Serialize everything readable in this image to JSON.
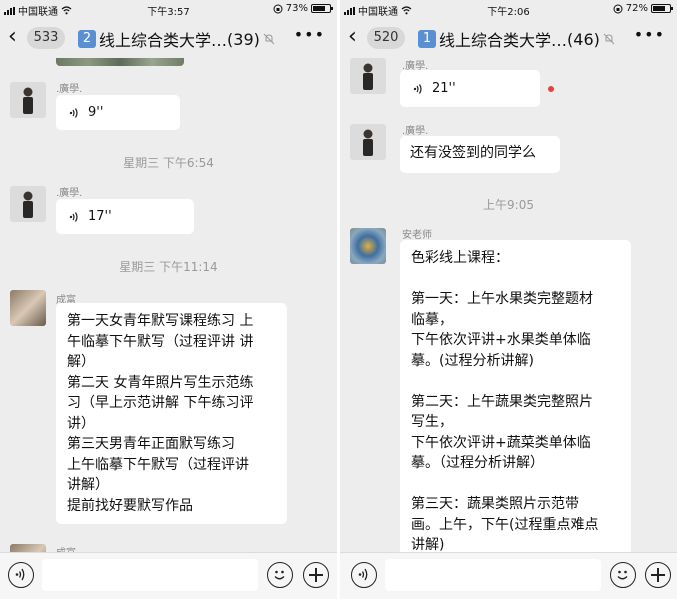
{
  "left_phone": {
    "status": {
      "carrier": "中国联通",
      "time": "下午3:57",
      "battery": "73%",
      "battery_level": 0.73
    },
    "nav": {
      "unread": "533",
      "group_index": "2",
      "title": "线上综合类大学…",
      "member_count": "(39)"
    },
    "messages": {
      "m1": {
        "sender": ".廣學.",
        "duration": "9''"
      },
      "t1": "星期三 下午6:54",
      "m2": {
        "sender": ".廣學.",
        "duration": "17''"
      },
      "t2": "星期三 下午11:14",
      "m3": {
        "sender": "成富",
        "text": "第一天女青年默写课程练习 上\n午临摹下午默写（过程评讲 讲\n解）\n第二天 女青年照片写生示范练\n习（早上示范讲解 下午练习评\n讲）\n第三天男青年正面默写练习\n上午临摹下午默写（过程评讲\n讲解）\n提前找好要默写作品"
      },
      "m4": {
        "sender": "成富"
      }
    }
  },
  "right_phone": {
    "status": {
      "carrier": "中国联通",
      "time": "下午2:06",
      "battery": "72%",
      "battery_level": 0.72
    },
    "nav": {
      "unread": "520",
      "group_index": "1",
      "title": "线上综合类大学…",
      "member_count": "(46)"
    },
    "messages": {
      "m1": {
        "sender": ".廣學.",
        "duration": "21''"
      },
      "m2": {
        "sender": ".廣學.",
        "text": "还有没签到的同学么"
      },
      "t1": "上午9:05",
      "m3": {
        "sender": "安老师",
        "text": "色彩线上课程：\n\n第一天：上午水果类完整题材\n临摹，\n下午依次评讲+水果类单体临\n摹。(过程分析讲解)\n\n第二天：上午蔬果类完整照片\n写生，\n下午依次评讲+蔬菜类单体临\n摹。（过程分析讲解）\n\n第三天：蔬果类照片示范带\n画。上午，下午(过程重点难点\n讲解)"
      }
    }
  },
  "colors": {
    "chat_bg": "#ededed",
    "bubble": "#ffffff",
    "group_badge": "#5a8fd1",
    "unread_dot": "#e64340"
  }
}
